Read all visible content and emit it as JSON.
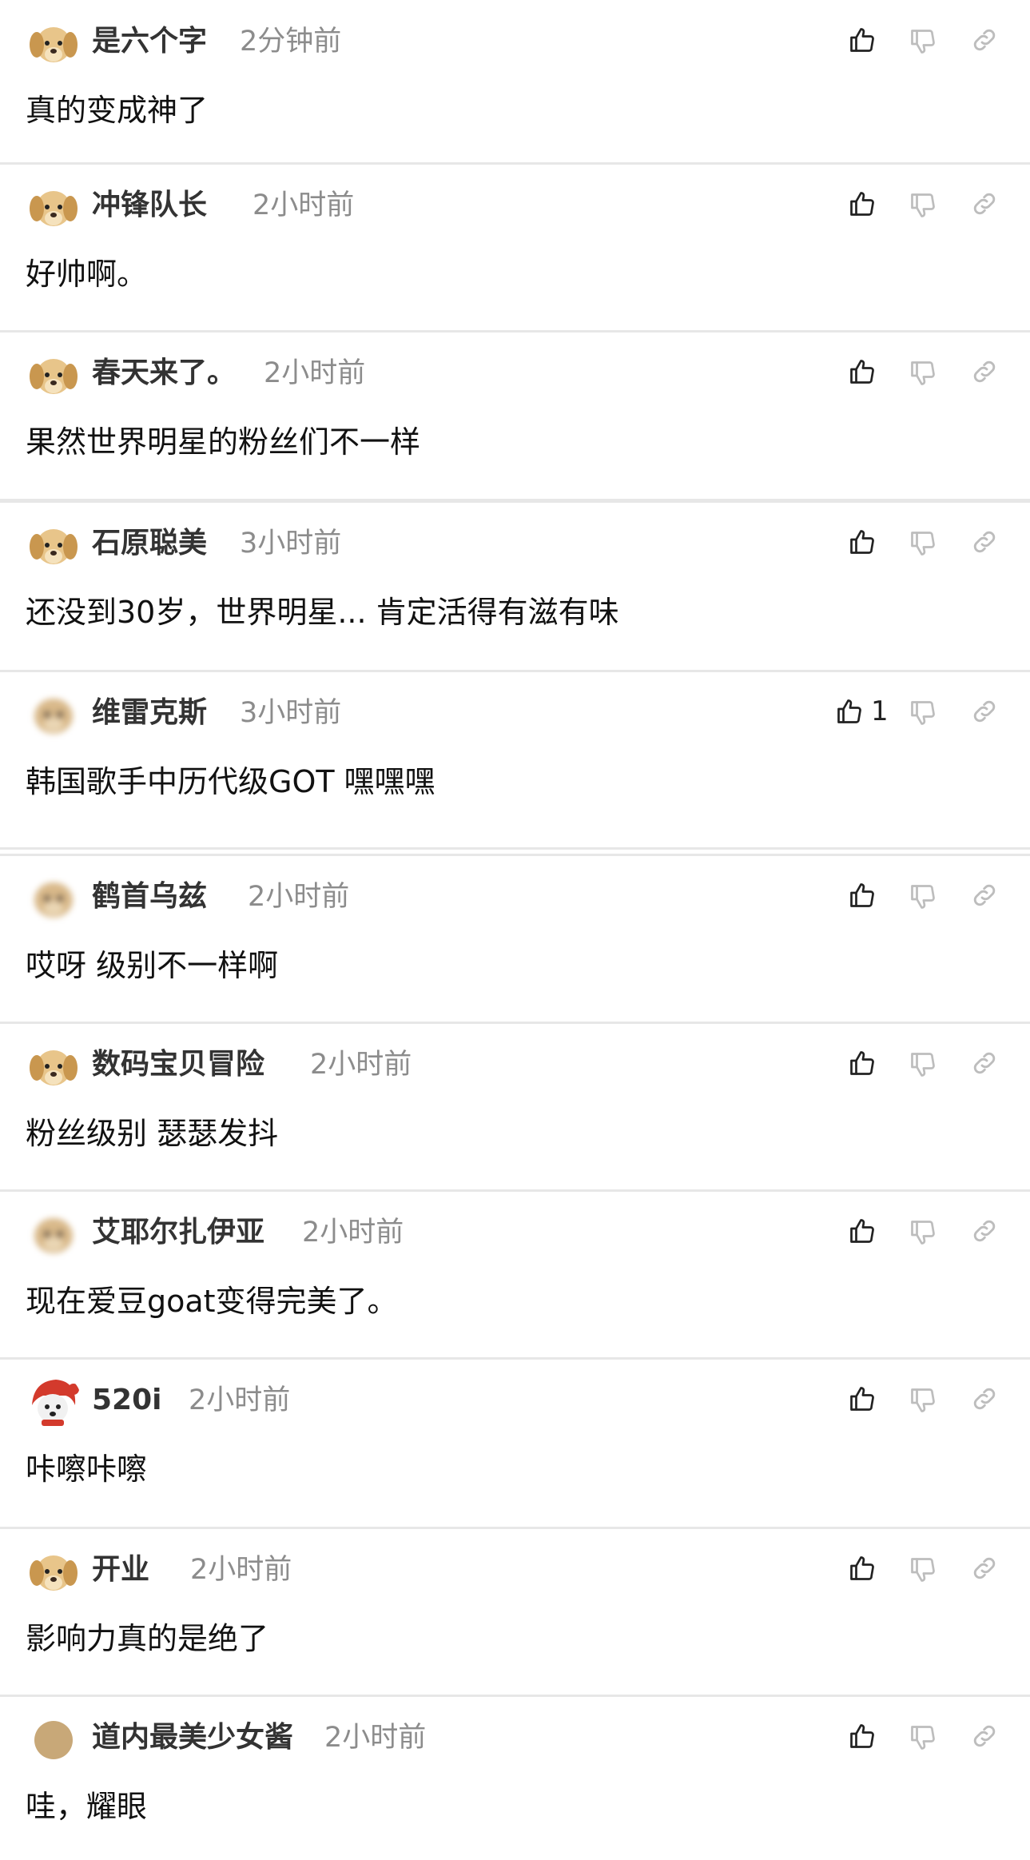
{
  "comments": [
    {
      "username": "是六个字",
      "time": "2分钟前",
      "text": "真的变成神了",
      "avatar": "puppy-avatar",
      "likes": ""
    },
    {
      "username": "冲锋队长",
      "time": "2小时前",
      "text": "好帅啊。",
      "avatar": "puppy-avatar",
      "likes": ""
    },
    {
      "username": "春天来了。",
      "time": "2小时前",
      "text": "果然世界明星的粉丝们不一样",
      "avatar": "puppy-avatar",
      "likes": ""
    },
    {
      "username": "石原聪美",
      "time": "3小时前",
      "text": "还没到30岁，世界明星... 肯定活得有滋有味",
      "avatar": "puppy-avatar",
      "likes": ""
    },
    {
      "username": "维雷克斯",
      "time": "3小时前",
      "text": "韩国歌手中历代级GOT 嘿嘿嘿",
      "avatar": "blurred-avatar",
      "likes": "1"
    },
    {
      "username": "鹤首乌兹",
      "time": "2小时前",
      "text": "哎呀 级别不一样啊",
      "avatar": "blurred-avatar",
      "likes": ""
    },
    {
      "username": "数码宝贝冒险",
      "time": "2小时前",
      "text": "粉丝级别 瑟瑟发抖",
      "avatar": "puppy-avatar",
      "likes": ""
    },
    {
      "username": "艾耶尔扎伊亚",
      "time": "2小时前",
      "text": "现在爱豆goat变得完美了。",
      "avatar": "blurred-avatar",
      "likes": ""
    },
    {
      "username": "520i",
      "time": "2小时前",
      "text": "咔嚓咔嚓",
      "avatar": "red-hood-puppy-avatar",
      "likes": ""
    },
    {
      "username": "开业",
      "time": "2小时前",
      "text": "影响力真的是绝了",
      "avatar": "puppy-avatar",
      "likes": ""
    },
    {
      "username": "道内最美少女酱",
      "time": "2小时前",
      "text": "哇，耀眼",
      "avatar": "plain-circle-avatar",
      "likes": ""
    }
  ],
  "icons": {
    "like": "thumbs-up-icon",
    "dislike": "thumbs-down-icon",
    "link": "link-icon"
  },
  "colors": {
    "username": "#333333",
    "time": "#8c8c8c",
    "divider": "#e7e7e7"
  }
}
